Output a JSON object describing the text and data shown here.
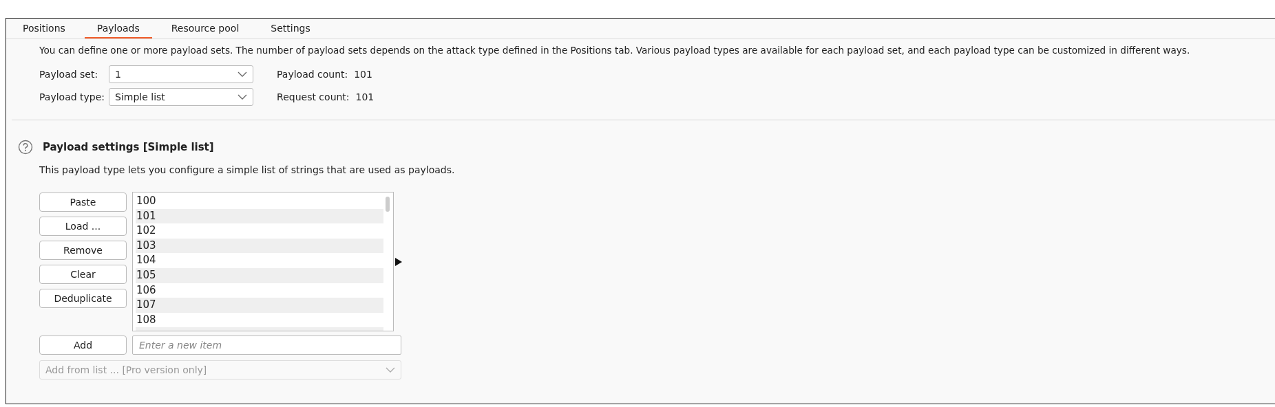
{
  "tabs": [
    {
      "label": "Positions",
      "selected": false
    },
    {
      "label": "Payloads",
      "selected": true
    },
    {
      "label": "Resource pool",
      "selected": false
    },
    {
      "label": "Settings",
      "selected": false
    }
  ],
  "intro": "You can define one or more payload sets. The number of payload sets depends on the attack type defined in the Positions tab. Various payload types are available for each payload set, and each payload type can be customized in different ways.",
  "payload_set": {
    "label": "Payload set:",
    "value": "1"
  },
  "payload_type": {
    "label": "Payload type:",
    "value": "Simple list"
  },
  "payload_count": {
    "label": "Payload count:",
    "value": "101"
  },
  "request_count": {
    "label": "Request count:",
    "value": "101"
  },
  "settings": {
    "title": "Payload settings [Simple list]",
    "description": "This payload type lets you configure a simple list of strings that are used as payloads.",
    "buttons": [
      "Paste",
      "Load ...",
      "Remove",
      "Clear",
      "Deduplicate"
    ],
    "items": [
      "100",
      "101",
      "102",
      "103",
      "104",
      "105",
      "106",
      "107",
      "108"
    ],
    "add_button": "Add",
    "new_item": {
      "placeholder": "Enter a new item"
    },
    "add_from_list": {
      "label": "Add from list ... [Pro version only]",
      "disabled": true
    }
  }
}
